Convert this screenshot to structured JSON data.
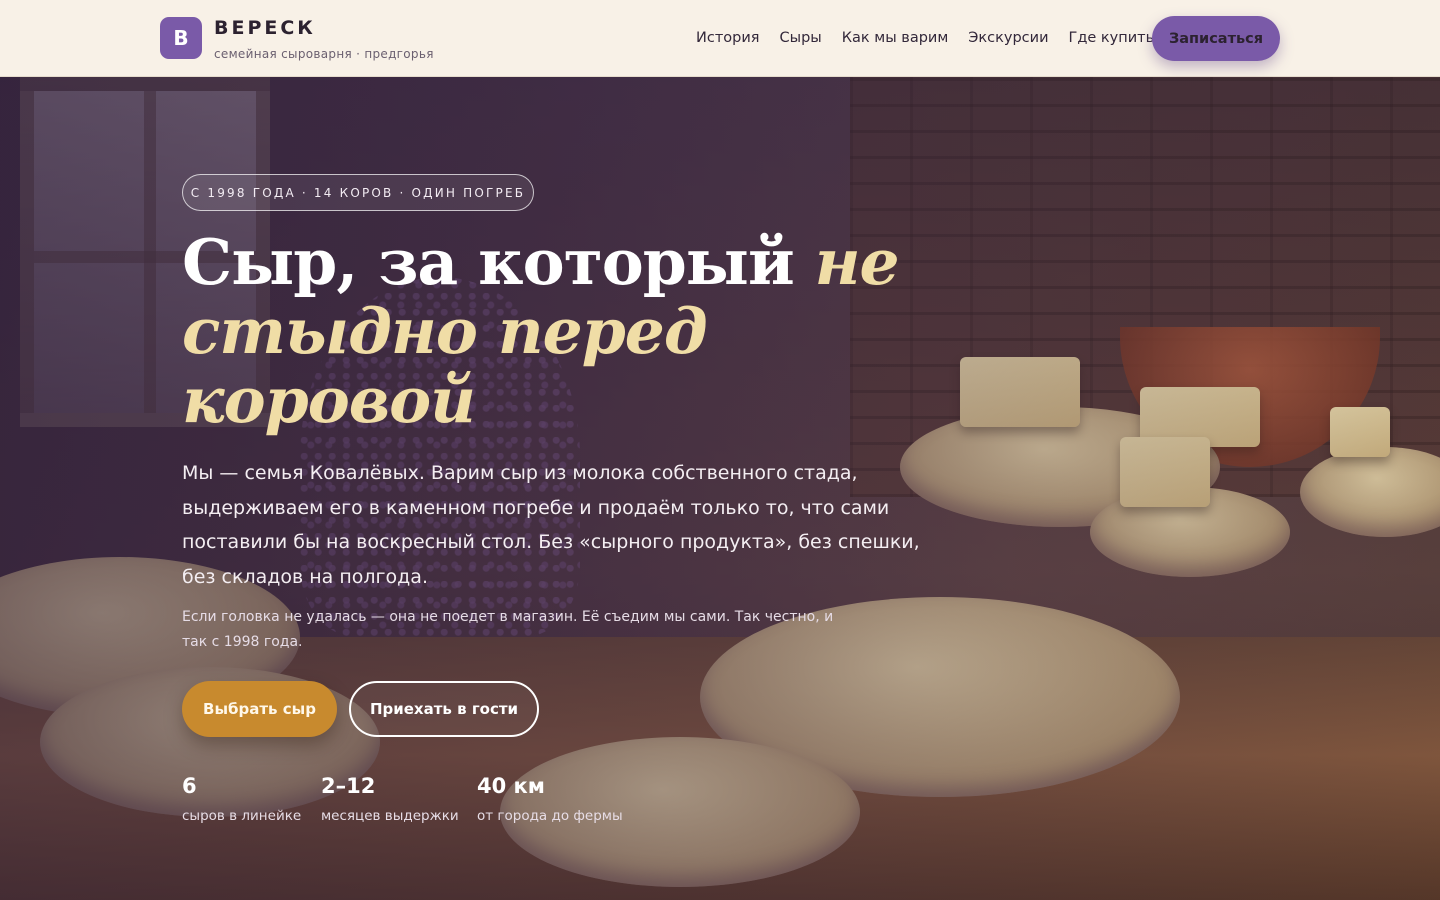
{
  "brand": {
    "logo_letter": "В",
    "name": "ВЕРЕСК",
    "tagline": "семейная сыроварня · предгорья",
    "accent_color": "#7a5aa8"
  },
  "nav": {
    "items": [
      {
        "label": "История"
      },
      {
        "label": "Сыры"
      },
      {
        "label": "Как мы варим"
      },
      {
        "label": "Экскурсии"
      },
      {
        "label": "Где купить"
      }
    ],
    "cta_label": "Записаться"
  },
  "hero": {
    "badge": "С 1998 ГОДА · 14 КОРОВ · ОДИН ПОГРЕБ",
    "headline_plain": "Сыр, за который ",
    "headline_accent_1": "не",
    "headline_accent_2": "стыдно перед",
    "headline_accent_3": "коровой",
    "lead": "Мы — семья Ковалёвых. Варим сыр из молока собственного стада, выдерживаем его в каменном погребе и продаём только то, что сами поставили бы на воскресный стол. Без «сырного продукта», без спешки, без складов на полгода.",
    "note": "Если головка не удалась — она не поедет в магазин. Её съедим мы сами. Так честно, и так с 1998 года.",
    "primary_button": "Выбрать сыр",
    "secondary_button": "Приехать в гости",
    "primary_color": "#c88a2e",
    "headline_accent_color": "#f0dda6"
  },
  "stats": [
    {
      "value": "6",
      "label": "сыров в линейке"
    },
    {
      "value": "2–12",
      "label": "месяцев выдержки"
    },
    {
      "value": "40 км",
      "label": "от города до фермы"
    }
  ]
}
